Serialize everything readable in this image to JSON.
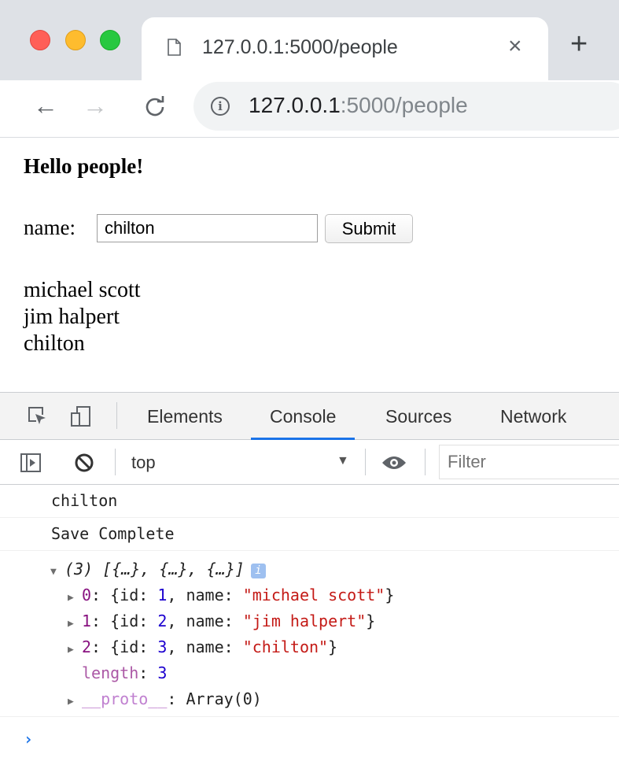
{
  "browser": {
    "tab_title": "127.0.0.1:5000/people",
    "tab_close": "×",
    "new_tab": "+",
    "url_host": "127.0.0.1",
    "url_path": ":5000/people",
    "nav": {
      "back": "←",
      "forward": "→",
      "reload": "C"
    },
    "info_icon": "i"
  },
  "page": {
    "heading": "Hello people!",
    "name_label": "name:",
    "name_value": "chilton",
    "submit_label": "Submit",
    "people": [
      "michael scott",
      "jim halpert",
      "chilton"
    ]
  },
  "devtools": {
    "tabs": [
      "Elements",
      "Console",
      "Sources",
      "Network"
    ],
    "active_tab": "Console",
    "context": "top",
    "filter_placeholder": "Filter",
    "console": {
      "logs": [
        "chilton",
        "Save Complete"
      ],
      "array_summary": "(3) [{…}, {…}, {…}]",
      "info_badge": "i",
      "items": [
        {
          "index": "0",
          "id": "1",
          "name": "\"michael scott\""
        },
        {
          "index": "1",
          "id": "2",
          "name": "\"jim halpert\""
        },
        {
          "index": "2",
          "id": "3",
          "name": "\"chilton\""
        }
      ],
      "length_key": "length",
      "length_value": "3",
      "proto_key": "__proto__",
      "proto_value": "Array(0)",
      "prompt": "›"
    }
  },
  "colors": {
    "accent": "#1a73e8",
    "string": "#c41a16",
    "number": "#1c00cf",
    "key": "#881280"
  }
}
